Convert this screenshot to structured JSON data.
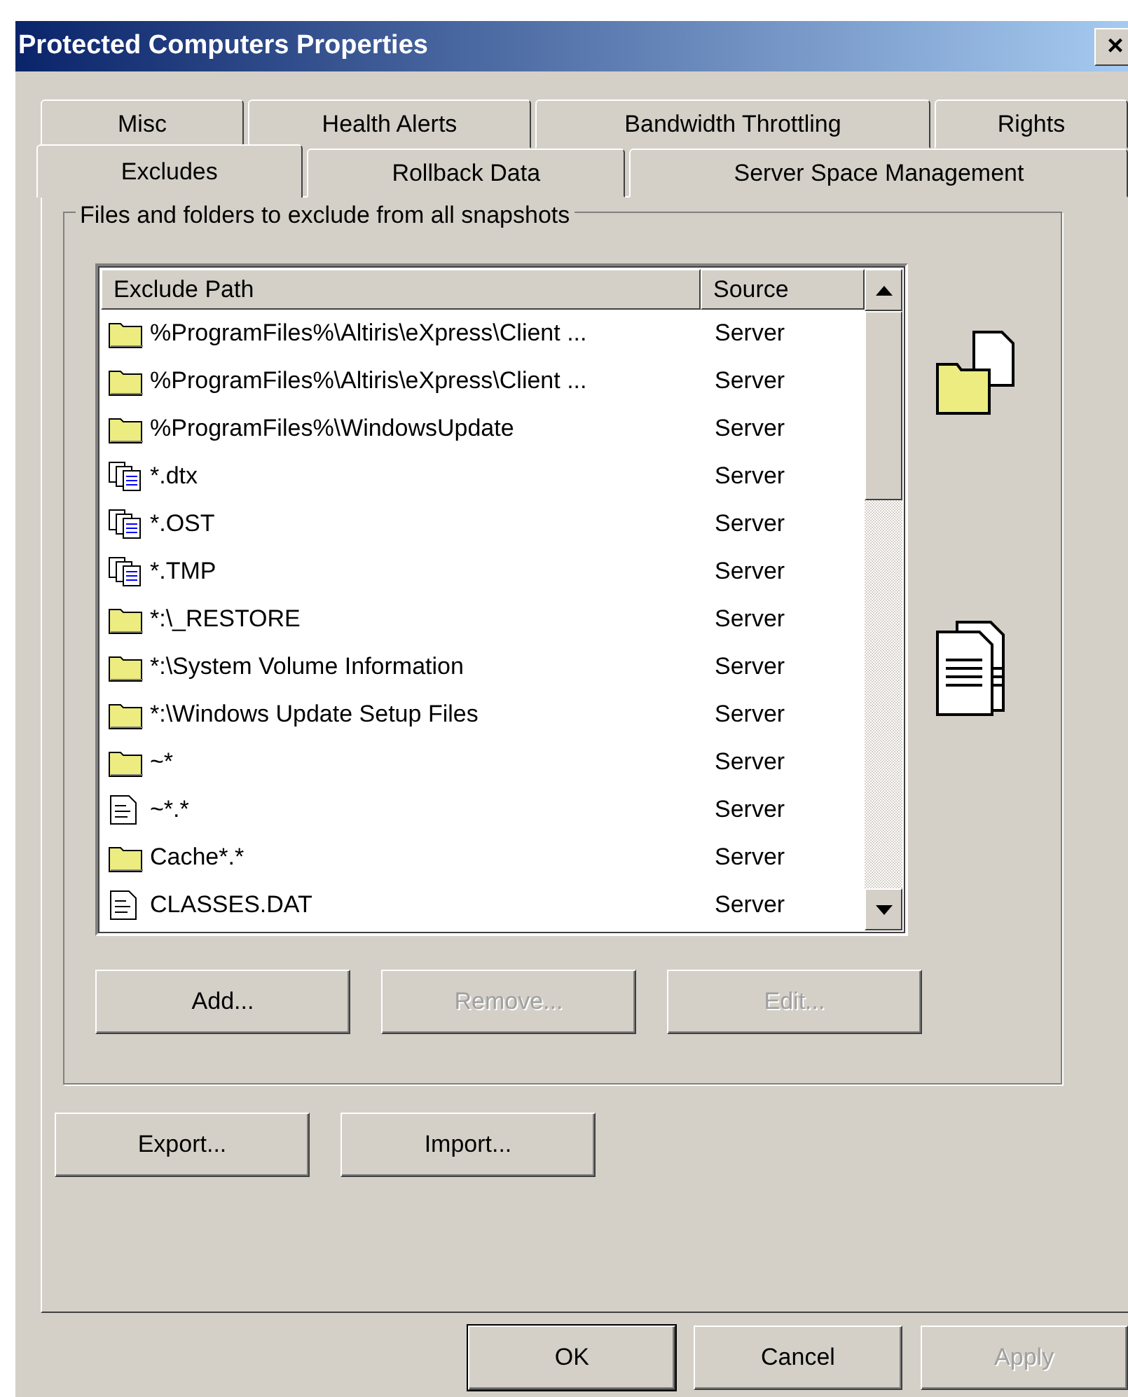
{
  "window": {
    "title": "Protected Computers Properties",
    "close": "×"
  },
  "tab_rows": [
    [
      {
        "label": "Misc",
        "selected": false
      },
      {
        "label": "Health Alerts",
        "selected": false
      },
      {
        "label": "Bandwidth Throttling",
        "selected": false
      },
      {
        "label": "Rights",
        "selected": false
      }
    ],
    [
      {
        "label": "Excludes",
        "selected": true
      },
      {
        "label": "Rollback Data",
        "selected": false
      },
      {
        "label": "Server Space Management",
        "selected": false
      }
    ]
  ],
  "group": {
    "title": "Files and folders to exclude from all snapshots"
  },
  "table": {
    "columns": [
      "Exclude Path",
      "Source"
    ],
    "rows": [
      {
        "kind": "folder",
        "path": "%ProgramFiles%\\Altiris\\eXpress\\Client ...",
        "source": "Server"
      },
      {
        "kind": "folder",
        "path": "%ProgramFiles%\\Altiris\\eXpress\\Client ...",
        "source": "Server"
      },
      {
        "kind": "folder",
        "path": "%ProgramFiles%\\WindowsUpdate",
        "source": "Server"
      },
      {
        "kind": "pattern",
        "path": "*.dtx",
        "source": "Server"
      },
      {
        "kind": "pattern",
        "path": "*.OST",
        "source": "Server"
      },
      {
        "kind": "pattern",
        "path": "*.TMP",
        "source": "Server"
      },
      {
        "kind": "folder",
        "path": "*:\\_RESTORE",
        "source": "Server"
      },
      {
        "kind": "folder",
        "path": "*:\\System Volume Information",
        "source": "Server"
      },
      {
        "kind": "folder",
        "path": "*:\\Windows Update Setup Files",
        "source": "Server"
      },
      {
        "kind": "folder",
        "path": "~*",
        "source": "Server"
      },
      {
        "kind": "file",
        "path": "~*.*",
        "source": "Server"
      },
      {
        "kind": "folder",
        "path": "Cache*.*",
        "source": "Server"
      },
      {
        "kind": "file",
        "path": "CLASSES.DAT",
        "source": "Server"
      }
    ]
  },
  "list_buttons": [
    {
      "label": "Add...",
      "disabled": false
    },
    {
      "label": "Remove...",
      "disabled": true
    },
    {
      "label": "Edit...",
      "disabled": true
    }
  ],
  "io_buttons": [
    {
      "label": "Export...",
      "disabled": false
    },
    {
      "label": "Import...",
      "disabled": false
    }
  ],
  "dialog_buttons": [
    {
      "label": "OK",
      "disabled": false,
      "default": true
    },
    {
      "label": "Cancel",
      "disabled": false,
      "default": false
    },
    {
      "label": "Apply",
      "disabled": true,
      "default": false
    }
  ]
}
